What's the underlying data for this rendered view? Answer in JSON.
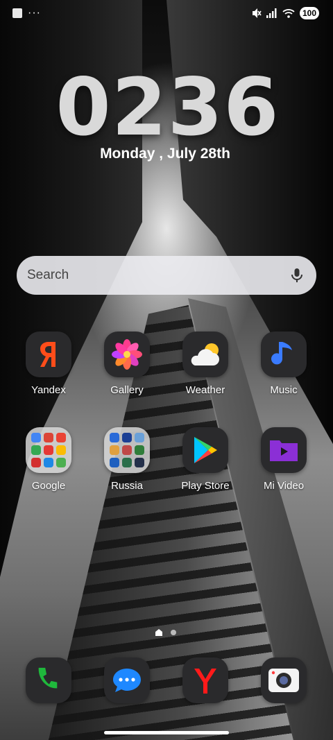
{
  "status_bar": {
    "battery": "100",
    "icons": [
      "notification-square-icon",
      "more-dots-icon",
      "mute-icon",
      "signal-icon",
      "wifi-icon",
      "battery-icon"
    ],
    "more": "···"
  },
  "clock": {
    "d1": "0",
    "d2": "2",
    "d3": "3",
    "d4": "6"
  },
  "date": "Monday , July 28th",
  "search": {
    "label": "Search",
    "icon": "mic-icon"
  },
  "apps": [
    {
      "label": "Yandex",
      "icon": "yandex-icon"
    },
    {
      "label": "Gallery",
      "icon": "gallery-flower-icon"
    },
    {
      "label": "Weather",
      "icon": "weather-icon"
    },
    {
      "label": "Music",
      "icon": "music-note-icon"
    },
    {
      "label": "Google",
      "icon": "google-folder-icon"
    },
    {
      "label": "Russia",
      "icon": "russia-folder-icon"
    },
    {
      "label": "Play Store",
      "icon": "play-store-icon"
    },
    {
      "label": "Mi Video",
      "icon": "mi-video-icon"
    }
  ],
  "dock": [
    "phone-icon",
    "messages-icon",
    "yandex-browser-icon",
    "camera-icon"
  ],
  "colors": {
    "accent_orange": "#ff4d1a",
    "phone_green": "#1fb83c",
    "message_blue": "#1e88ff"
  }
}
